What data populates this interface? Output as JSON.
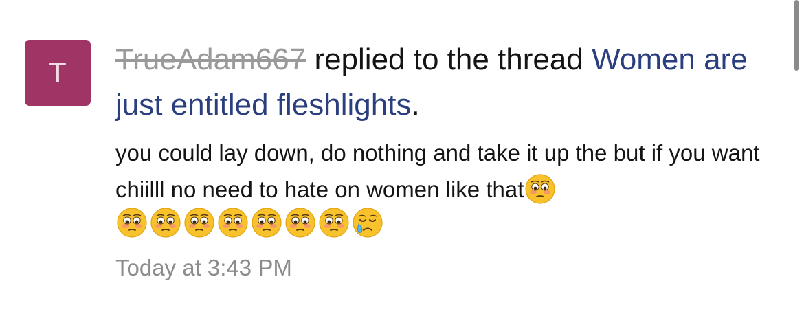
{
  "notification": {
    "avatar_letter": "T",
    "avatar_color": "#9e3564",
    "username": "TrueAdam667",
    "action_text": "replied to the thread",
    "thread_title": "Women are just entitled fleshlights",
    "trailing_punct": ".",
    "message_text": "you could lay down, do nothing and take it up the but if you want chiilll no need to hate on women like that",
    "inline_emoji": "flushed-face-icon",
    "emoji_row": [
      "flushed-face-icon",
      "flushed-face-icon",
      "flushed-face-icon",
      "flushed-face-icon",
      "flushed-face-icon",
      "flushed-face-icon",
      "flushed-face-icon",
      "crying-face-icon"
    ],
    "timestamp": "Today at 3:43 PM"
  },
  "colors": {
    "link": "#2b3f7e",
    "username_struck": "#9a9a9a",
    "timestamp": "#8c8c8c",
    "text": "#141414"
  }
}
